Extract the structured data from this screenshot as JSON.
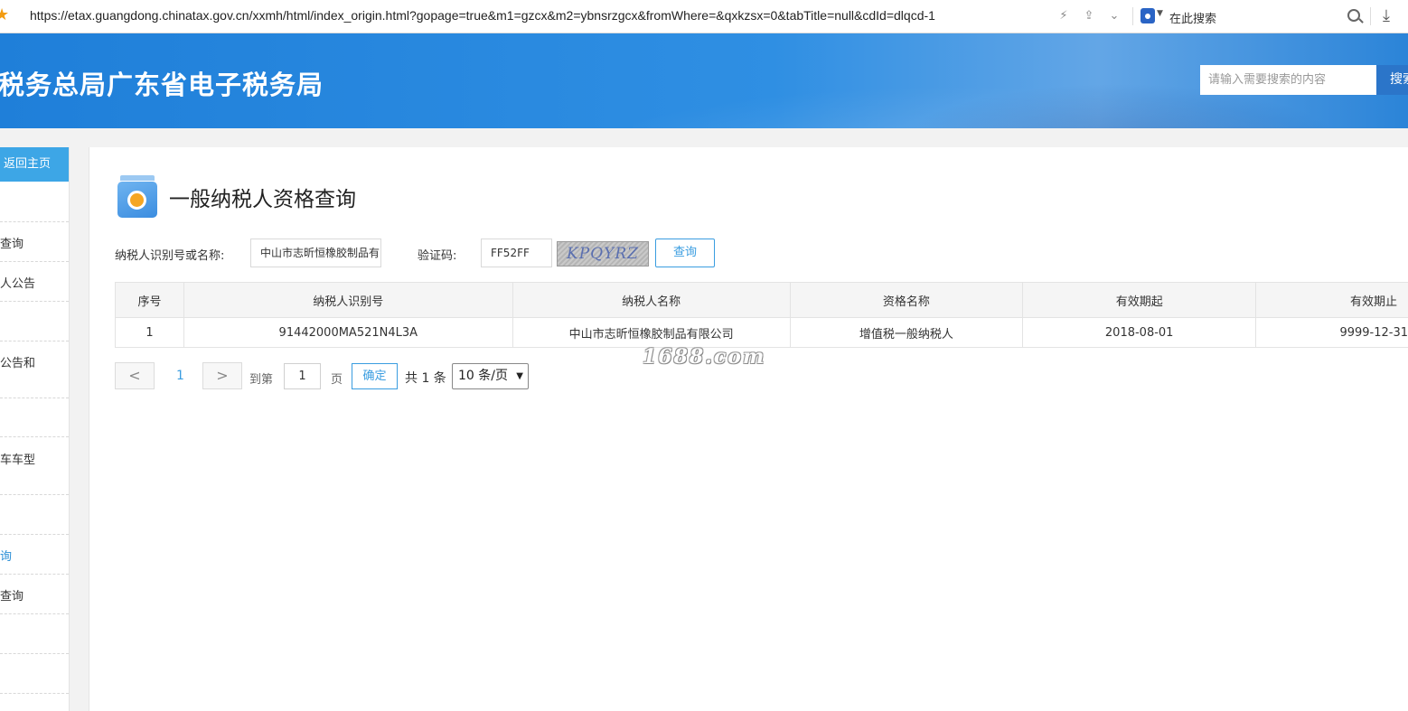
{
  "browser": {
    "url": "https://etax.guangdong.chinatax.gov.cn/xxmh/html/index_origin.html?gopage=true&m1=gzcx&m2=ybnsrzgcx&fromWhere=&qxkzsx=0&tabTitle=null&cdId=dlqcd-1",
    "search_engine_label": "在此搜索"
  },
  "header": {
    "site_title": "税务总局广东省电子税务局",
    "search_placeholder": "请输入需要搜索的内容",
    "search_button": "搜索"
  },
  "sidebar": {
    "back_label": "返回主页",
    "items": [
      {
        "label": "查询"
      },
      {
        "label": "人公告"
      },
      {
        "label": "公告和"
      },
      {
        "label": "车车型"
      },
      {
        "label": "询",
        "active": true
      },
      {
        "label": "查询"
      }
    ]
  },
  "main": {
    "page_title": "一般纳税人资格查询",
    "form": {
      "taxpayer_label": "纳税人识别号或名称:",
      "taxpayer_value": "中山市志昕恒橡胶制品有",
      "captcha_label": "验证码:",
      "captcha_value": "FF52FF",
      "captcha_image_text": "KPQYRZ",
      "query_button": "查询"
    },
    "table": {
      "headers": [
        "序号",
        "纳税人识别号",
        "纳税人名称",
        "资格名称",
        "有效期起",
        "有效期止"
      ],
      "rows": [
        [
          "1",
          "91442000MA521N4L3A",
          "中山市志昕恒橡胶制品有限公司",
          "增值税一般纳税人",
          "2018-08-01",
          "9999-12-31"
        ]
      ]
    },
    "pagination": {
      "prev": "<",
      "current_page": "1",
      "next": ">",
      "goto_label": "到第",
      "goto_value": "1",
      "page_unit": "页",
      "confirm": "确定",
      "total": "共 1 条",
      "page_size": "10 条/页"
    }
  },
  "watermark": "1688.com"
}
